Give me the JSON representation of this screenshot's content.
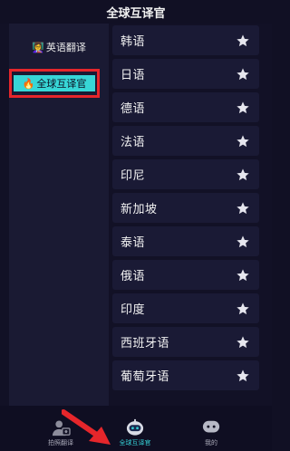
{
  "header": {
    "title": "全球互译官"
  },
  "sidebar": {
    "items": [
      {
        "label": "英语翻译",
        "emoji": "👩‍🏫"
      },
      {
        "label": "全球互译官",
        "emoji": "🔥"
      }
    ]
  },
  "languages": [
    {
      "name": "韩语"
    },
    {
      "name": "日语"
    },
    {
      "name": "德语"
    },
    {
      "name": "法语"
    },
    {
      "name": "印尼"
    },
    {
      "name": "新加坡"
    },
    {
      "name": "泰语"
    },
    {
      "name": "俄语"
    },
    {
      "name": "印度"
    },
    {
      "name": "西班牙语"
    },
    {
      "name": "葡萄牙语"
    }
  ],
  "tabbar": {
    "tabs": [
      {
        "label": "拍照翻译",
        "icon": "camera-person-icon"
      },
      {
        "label": "全球互译官",
        "icon": "robot-icon"
      },
      {
        "label": "我的",
        "icon": "profile-icon"
      }
    ]
  },
  "colors": {
    "background": "#111024",
    "active_highlight": "#37d6d6",
    "annotation_red": "#e6262b"
  }
}
